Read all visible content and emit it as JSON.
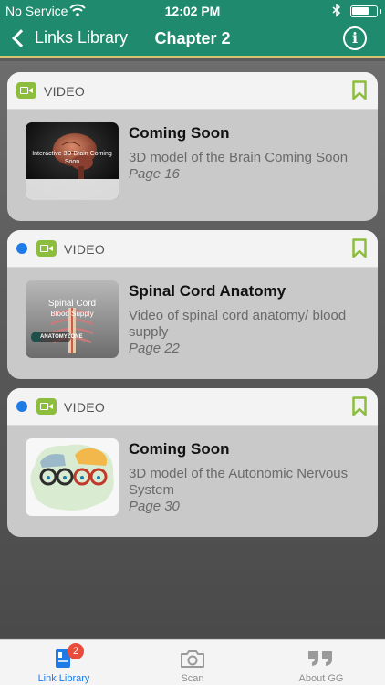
{
  "status_bar": {
    "carrier": "No Service",
    "time": "12:02 PM"
  },
  "nav": {
    "back_label": "Links Library",
    "title": "Chapter 2",
    "info_label": "i"
  },
  "cards": [
    {
      "type_label": "VIDEO",
      "unread": false,
      "title": "Coming Soon",
      "description": "3D model of the Brain Coming Soon",
      "page": "Page 16",
      "thumbnail_text": "Interactive 3D Brain Coming Soon"
    },
    {
      "type_label": "VIDEO",
      "unread": true,
      "title": "Spinal Cord Anatomy",
      "description": "Video of spinal cord anatomy/ blood supply",
      "page": "Page 22",
      "thumbnail_text": "Spinal Cord",
      "thumbnail_subtext": "Blood Supply",
      "thumbnail_brand": "ANATOMYZONE"
    },
    {
      "type_label": "VIDEO",
      "unread": true,
      "title": "Coming Soon",
      "description": "3D model of the Autonomic Nervous System",
      "page": "Page 30"
    }
  ],
  "tabs": [
    {
      "label": "Link Library",
      "active": true,
      "badge": "2"
    },
    {
      "label": "Scan",
      "active": false
    },
    {
      "label": "About GG",
      "active": false
    }
  ],
  "colors": {
    "header_green": "#1f8a6d",
    "accent_gold": "#d7c56a",
    "video_green": "#8cbd3c",
    "unread_blue": "#1e7be5",
    "badge_red": "#e74c3c"
  },
  "icons": {
    "back": "chevron-left-icon",
    "info": "info-icon",
    "video": "video-camera-icon",
    "bookmark": "bookmark-icon",
    "link_library": "book-icon",
    "scan": "camera-icon",
    "about": "quote-icon"
  }
}
